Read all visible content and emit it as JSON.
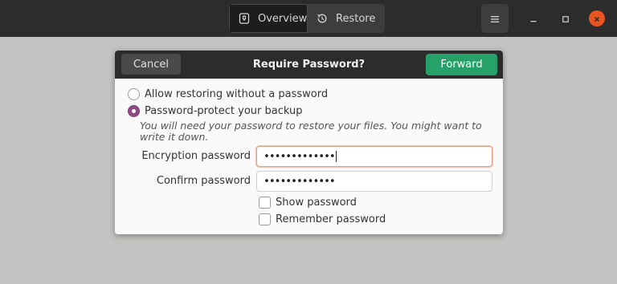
{
  "headerbar": {
    "tabs": [
      {
        "label": "Overview",
        "icon": "backup-icon"
      },
      {
        "label": "Restore",
        "icon": "history-icon"
      }
    ],
    "menu_icon": "hamburger-icon",
    "window_controls": [
      "minimize-icon",
      "maximize-icon",
      "close-icon"
    ]
  },
  "dialog": {
    "title": "Require Password?",
    "cancel_label": "Cancel",
    "forward_label": "Forward",
    "options": [
      {
        "label": "Allow restoring without a password",
        "selected": false
      },
      {
        "label": "Password-protect your backup",
        "selected": true
      }
    ],
    "hint": "You will need your password to restore your files. You might want to write it down.",
    "encryption_label": "Encryption password",
    "encryption_value": "•••••••••••••",
    "confirm_label": "Confirm password",
    "confirm_value": "•••••••••••••",
    "show_password_label": "Show password",
    "remember_password_label": "Remember password"
  },
  "colors": {
    "headerbar": "#2c2c2c",
    "accent_green": "#26a269",
    "radio_selected": "#8f4a84",
    "close_orange": "#e95420",
    "focus_border": "#e7a28a"
  }
}
